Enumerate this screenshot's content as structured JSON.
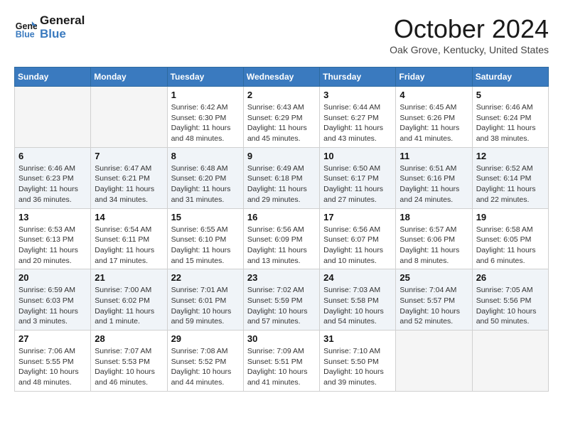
{
  "header": {
    "logo_line1": "General",
    "logo_line2": "Blue",
    "month": "October 2024",
    "location": "Oak Grove, Kentucky, United States"
  },
  "weekdays": [
    "Sunday",
    "Monday",
    "Tuesday",
    "Wednesday",
    "Thursday",
    "Friday",
    "Saturday"
  ],
  "weeks": [
    [
      {
        "day": "",
        "info": ""
      },
      {
        "day": "",
        "info": ""
      },
      {
        "day": "1",
        "info": "Sunrise: 6:42 AM\nSunset: 6:30 PM\nDaylight: 11 hours and 48 minutes."
      },
      {
        "day": "2",
        "info": "Sunrise: 6:43 AM\nSunset: 6:29 PM\nDaylight: 11 hours and 45 minutes."
      },
      {
        "day": "3",
        "info": "Sunrise: 6:44 AM\nSunset: 6:27 PM\nDaylight: 11 hours and 43 minutes."
      },
      {
        "day": "4",
        "info": "Sunrise: 6:45 AM\nSunset: 6:26 PM\nDaylight: 11 hours and 41 minutes."
      },
      {
        "day": "5",
        "info": "Sunrise: 6:46 AM\nSunset: 6:24 PM\nDaylight: 11 hours and 38 minutes."
      }
    ],
    [
      {
        "day": "6",
        "info": "Sunrise: 6:46 AM\nSunset: 6:23 PM\nDaylight: 11 hours and 36 minutes."
      },
      {
        "day": "7",
        "info": "Sunrise: 6:47 AM\nSunset: 6:21 PM\nDaylight: 11 hours and 34 minutes."
      },
      {
        "day": "8",
        "info": "Sunrise: 6:48 AM\nSunset: 6:20 PM\nDaylight: 11 hours and 31 minutes."
      },
      {
        "day": "9",
        "info": "Sunrise: 6:49 AM\nSunset: 6:18 PM\nDaylight: 11 hours and 29 minutes."
      },
      {
        "day": "10",
        "info": "Sunrise: 6:50 AM\nSunset: 6:17 PM\nDaylight: 11 hours and 27 minutes."
      },
      {
        "day": "11",
        "info": "Sunrise: 6:51 AM\nSunset: 6:16 PM\nDaylight: 11 hours and 24 minutes."
      },
      {
        "day": "12",
        "info": "Sunrise: 6:52 AM\nSunset: 6:14 PM\nDaylight: 11 hours and 22 minutes."
      }
    ],
    [
      {
        "day": "13",
        "info": "Sunrise: 6:53 AM\nSunset: 6:13 PM\nDaylight: 11 hours and 20 minutes."
      },
      {
        "day": "14",
        "info": "Sunrise: 6:54 AM\nSunset: 6:11 PM\nDaylight: 11 hours and 17 minutes."
      },
      {
        "day": "15",
        "info": "Sunrise: 6:55 AM\nSunset: 6:10 PM\nDaylight: 11 hours and 15 minutes."
      },
      {
        "day": "16",
        "info": "Sunrise: 6:56 AM\nSunset: 6:09 PM\nDaylight: 11 hours and 13 minutes."
      },
      {
        "day": "17",
        "info": "Sunrise: 6:56 AM\nSunset: 6:07 PM\nDaylight: 11 hours and 10 minutes."
      },
      {
        "day": "18",
        "info": "Sunrise: 6:57 AM\nSunset: 6:06 PM\nDaylight: 11 hours and 8 minutes."
      },
      {
        "day": "19",
        "info": "Sunrise: 6:58 AM\nSunset: 6:05 PM\nDaylight: 11 hours and 6 minutes."
      }
    ],
    [
      {
        "day": "20",
        "info": "Sunrise: 6:59 AM\nSunset: 6:03 PM\nDaylight: 11 hours and 3 minutes."
      },
      {
        "day": "21",
        "info": "Sunrise: 7:00 AM\nSunset: 6:02 PM\nDaylight: 11 hours and 1 minute."
      },
      {
        "day": "22",
        "info": "Sunrise: 7:01 AM\nSunset: 6:01 PM\nDaylight: 10 hours and 59 minutes."
      },
      {
        "day": "23",
        "info": "Sunrise: 7:02 AM\nSunset: 5:59 PM\nDaylight: 10 hours and 57 minutes."
      },
      {
        "day": "24",
        "info": "Sunrise: 7:03 AM\nSunset: 5:58 PM\nDaylight: 10 hours and 54 minutes."
      },
      {
        "day": "25",
        "info": "Sunrise: 7:04 AM\nSunset: 5:57 PM\nDaylight: 10 hours and 52 minutes."
      },
      {
        "day": "26",
        "info": "Sunrise: 7:05 AM\nSunset: 5:56 PM\nDaylight: 10 hours and 50 minutes."
      }
    ],
    [
      {
        "day": "27",
        "info": "Sunrise: 7:06 AM\nSunset: 5:55 PM\nDaylight: 10 hours and 48 minutes."
      },
      {
        "day": "28",
        "info": "Sunrise: 7:07 AM\nSunset: 5:53 PM\nDaylight: 10 hours and 46 minutes."
      },
      {
        "day": "29",
        "info": "Sunrise: 7:08 AM\nSunset: 5:52 PM\nDaylight: 10 hours and 44 minutes."
      },
      {
        "day": "30",
        "info": "Sunrise: 7:09 AM\nSunset: 5:51 PM\nDaylight: 10 hours and 41 minutes."
      },
      {
        "day": "31",
        "info": "Sunrise: 7:10 AM\nSunset: 5:50 PM\nDaylight: 10 hours and 39 minutes."
      },
      {
        "day": "",
        "info": ""
      },
      {
        "day": "",
        "info": ""
      }
    ]
  ]
}
